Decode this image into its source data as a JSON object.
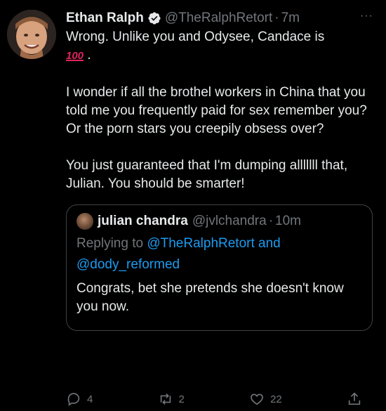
{
  "tweet": {
    "display_name": "Ethan Ralph",
    "handle": "@TheRalphRetort",
    "separator": "·",
    "time": "7m",
    "more": "···",
    "text_line1": "Wrong. Unlike you and Odysee, Candace is",
    "emoji_text": "100",
    "text_line1_end": ".",
    "para2": "I wonder if all the brothel workers in China that you told me you frequently paid for sex remember you? Or the porn stars you creepily obsess over?",
    "para3": "You just guaranteed that I'm dumping alllllll that, Julian. You should be smarter!"
  },
  "quote": {
    "display_name": "julian chandra",
    "handle": "@jvlchandra",
    "separator": "·",
    "time": "10m",
    "replying_prefix": "Replying to",
    "mention1": "@TheRalphRetort",
    "and_word": "and",
    "mention2": "@dody_reformed",
    "text": "Congrats, bet she pretends she doesn't know you now."
  },
  "actions": {
    "reply_count": "4",
    "retweet_count": "2",
    "like_count": "22"
  },
  "colors": {
    "background": "#000000",
    "text": "#e7e9ea",
    "muted": "#71767b",
    "link": "#1d9bf0",
    "border": "#3e4144",
    "verified": "#1d9bf0"
  }
}
